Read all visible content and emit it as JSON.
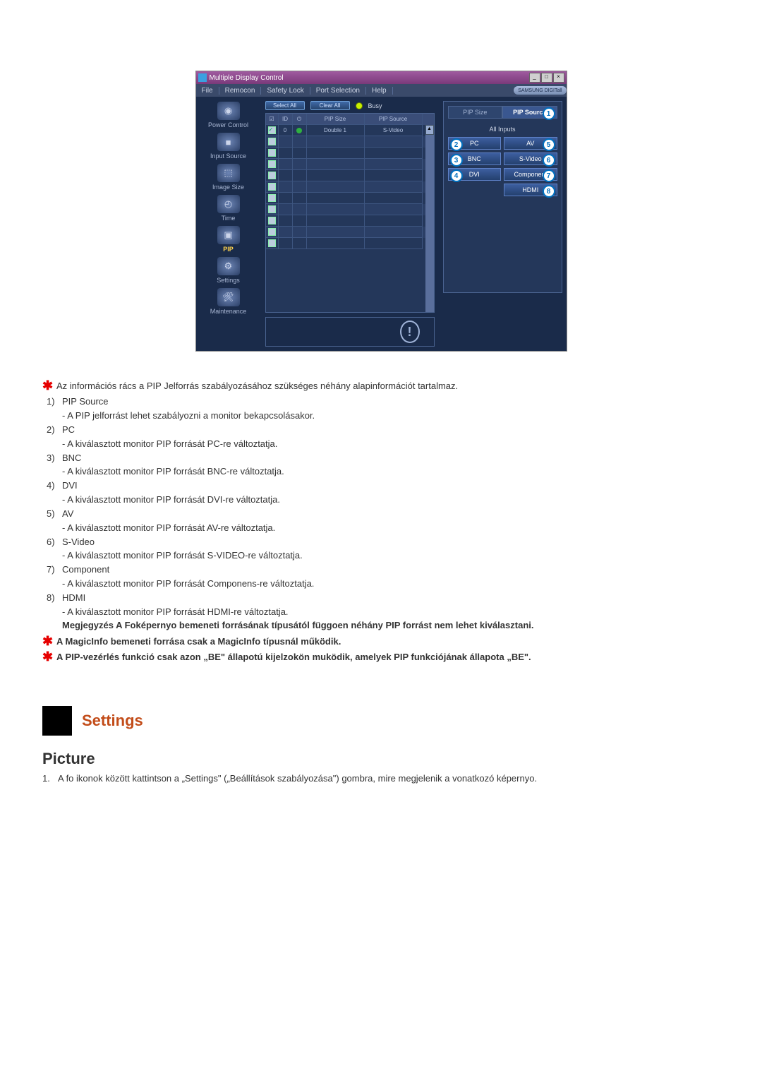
{
  "window": {
    "title": "Multiple Display Control",
    "menubar": [
      "File",
      "Remocon",
      "Safety Lock",
      "Port Selection",
      "Help"
    ],
    "brand": "SAMSUNG DIGITall"
  },
  "sidebar": [
    {
      "label": "Power Control",
      "icon": "◉"
    },
    {
      "label": "Input Source",
      "icon": "■"
    },
    {
      "label": "Image Size",
      "icon": "⬚"
    },
    {
      "label": "Time",
      "icon": "◴"
    },
    {
      "label": "PIP",
      "icon": "▣",
      "active": true
    },
    {
      "label": "Settings",
      "icon": "⚙"
    },
    {
      "label": "Maintenance",
      "icon": "🛠"
    }
  ],
  "toolbar": {
    "select_all": "Select All",
    "clear_all": "Clear All",
    "busy_label": "Busy"
  },
  "grid": {
    "headers": {
      "chk": "☑",
      "id": "ID",
      "pwr": "⏻",
      "size": "PIP Size",
      "src": "PIP Source"
    },
    "rows": [
      {
        "checked": true,
        "id": "0",
        "power": true,
        "size": "Double 1",
        "src": "S-Video"
      },
      {
        "checked": false,
        "id": "",
        "power": false,
        "size": "",
        "src": ""
      },
      {
        "checked": false,
        "id": "",
        "power": false,
        "size": "",
        "src": ""
      },
      {
        "checked": false,
        "id": "",
        "power": false,
        "size": "",
        "src": ""
      },
      {
        "checked": false,
        "id": "",
        "power": false,
        "size": "",
        "src": ""
      },
      {
        "checked": false,
        "id": "",
        "power": false,
        "size": "",
        "src": ""
      },
      {
        "checked": false,
        "id": "",
        "power": false,
        "size": "",
        "src": ""
      },
      {
        "checked": false,
        "id": "",
        "power": false,
        "size": "",
        "src": ""
      },
      {
        "checked": false,
        "id": "",
        "power": false,
        "size": "",
        "src": ""
      },
      {
        "checked": false,
        "id": "",
        "power": false,
        "size": "",
        "src": ""
      },
      {
        "checked": false,
        "id": "",
        "power": false,
        "size": "",
        "src": ""
      }
    ]
  },
  "right_panel": {
    "tabs": {
      "size": "PIP Size",
      "source": "PIP Source",
      "active_badge": "1"
    },
    "subhead": "All Inputs",
    "buttons": {
      "pc": {
        "label": "PC",
        "badge": "2"
      },
      "av": {
        "label": "AV",
        "badge": "5"
      },
      "bnc": {
        "label": "BNC",
        "badge": "3"
      },
      "svideo": {
        "label": "S-Video",
        "badge": "6"
      },
      "dvi": {
        "label": "DVI",
        "badge": "4"
      },
      "component": {
        "label": "Component",
        "badge": "7"
      },
      "hdmi": {
        "label": "HDMI",
        "badge": "8"
      }
    }
  },
  "status_icon": "!",
  "doc": {
    "intro_star": "Az információs rács a PIP Jelforrás szabályozásához szükséges néhány alapinformációt tartalmaz.",
    "items": [
      {
        "num": "1)",
        "title": "PIP Source",
        "desc": "- A PIP jelforrást lehet szabályozni a monitor bekapcsolásakor."
      },
      {
        "num": "2)",
        "title": "PC",
        "desc": "- A kiválasztott monitor PIP forrását PC-re változtatja."
      },
      {
        "num": "3)",
        "title": "BNC",
        "desc": "- A kiválasztott monitor PIP forrását BNC-re változtatja."
      },
      {
        "num": "4)",
        "title": "DVI",
        "desc": "- A kiválasztott monitor PIP forrását DVI-re változtatja."
      },
      {
        "num": "5)",
        "title": "AV",
        "desc": "- A kiválasztott monitor PIP forrását AV-re változtatja."
      },
      {
        "num": "6)",
        "title": "S-Video",
        "desc": "- A kiválasztott monitor PIP forrását S-VIDEO-re változtatja."
      },
      {
        "num": "7)",
        "title": "Component",
        "desc": "- A kiválasztott monitor PIP forrását Componens-re változtatja."
      },
      {
        "num": "8)",
        "title": "HDMI",
        "desc": "- A kiválasztott monitor PIP forrását HDMI-re változtatja."
      }
    ],
    "note_bold": "Megjegyzés A Foképernyo bemeneti forrásának típusától függoen néhány PIP forrást nem lehet kiválasztani.",
    "star2": "A MagicInfo bemeneti forrása csak a MagicInfo típusnál működik.",
    "star3": "A PIP-vezérlés funkció csak azon „BE\" állapotú kijelzokön muködik, amelyek PIP funkciójának állapota „BE\".",
    "section_title": "Settings",
    "subsection": "Picture",
    "ol1": "A fo ikonok között kattintson a „Settings\" („Beállítások szabályozása\") gombra, mire megjelenik a vonatkozó képernyo."
  }
}
